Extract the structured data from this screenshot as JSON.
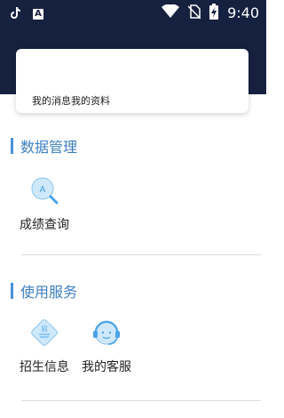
{
  "status_bar": {
    "time": "9:40",
    "left_icons": [
      "tiktok-icon",
      "a-badge-icon"
    ],
    "right_icons": [
      "wifi-icon",
      "no-sim-icon",
      "battery-charging-icon"
    ]
  },
  "profile_card": {
    "links": "我的消息我的资料"
  },
  "sections": [
    {
      "title": "数据管理",
      "items": [
        {
          "label": "成绩查询",
          "icon": "score-search-icon"
        }
      ]
    },
    {
      "title": "使用服务",
      "items": [
        {
          "label": "招生信息",
          "icon": "admissions-icon"
        },
        {
          "label": "我的客服",
          "icon": "customer-service-icon"
        }
      ]
    }
  ],
  "colors": {
    "header": "#16213f",
    "accent": "#3d7fc4",
    "icon_light": "#cfe8fb",
    "icon_mid": "#4aa3e8"
  }
}
